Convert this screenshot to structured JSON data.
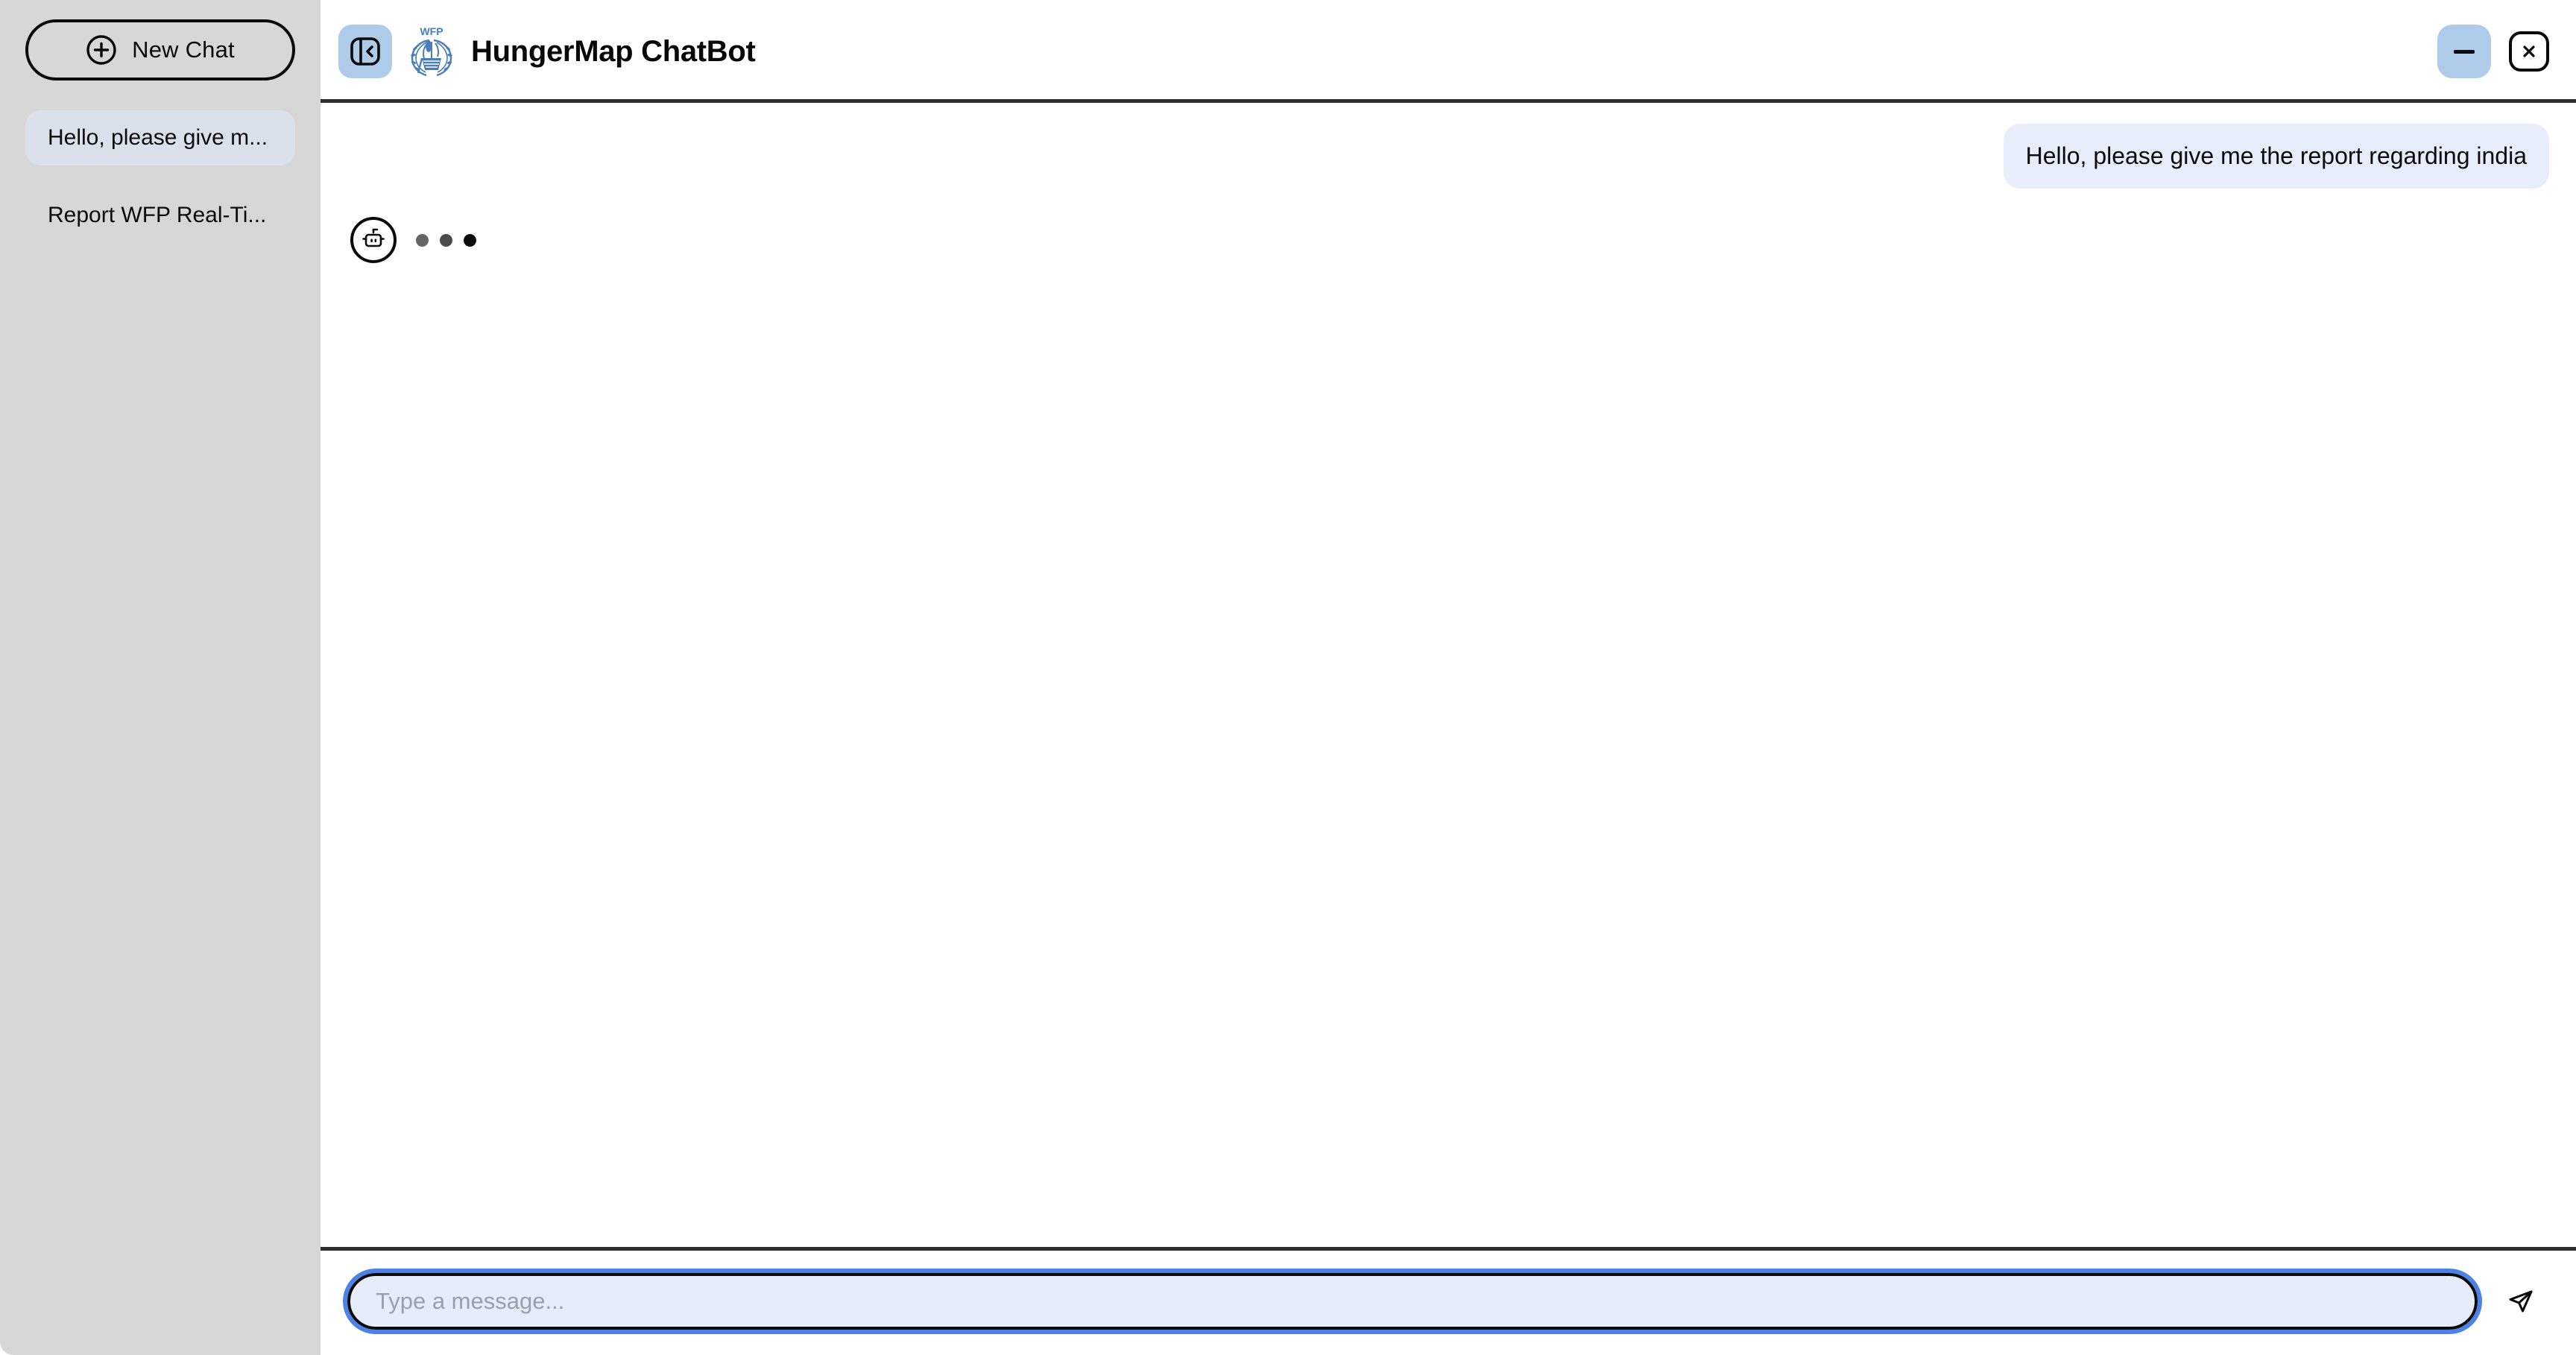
{
  "window": {
    "minimize_label": "—",
    "close_label": "×"
  },
  "sidebar": {
    "new_chat_label": "New Chat",
    "conversations": [
      {
        "label": "Hello, please give m...",
        "active": true
      },
      {
        "label": "Report WFP Real-Ti...",
        "active": false
      }
    ]
  },
  "header": {
    "title": "HungerMap ChatBot",
    "logo_text": "WFP"
  },
  "conversation": {
    "messages": [
      {
        "role": "user",
        "text": "Hello, please give me the report regarding india"
      },
      {
        "role": "assistant",
        "text": "",
        "state": "typing"
      }
    ]
  },
  "composer": {
    "placeholder": "Type a message...",
    "value": ""
  },
  "colors": {
    "sidebar_bg": "#d7d7d7",
    "accent_blue": "#aeccea",
    "focus_ring": "#4a82e8",
    "user_bubble": "#e7edfb",
    "active_item": "#dae1ea",
    "separator": "#2b2f36",
    "wfp_blue": "#4a7ebb"
  }
}
